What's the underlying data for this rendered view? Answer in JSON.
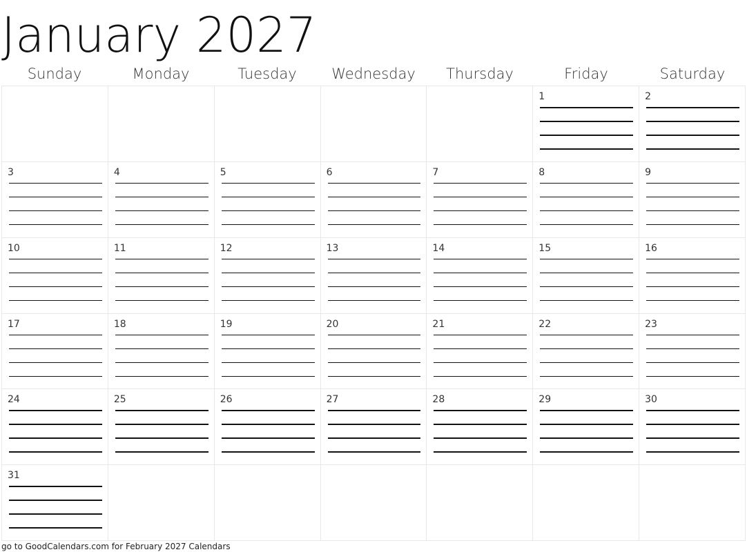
{
  "calendar": {
    "title": "January 2027",
    "weekdays": [
      "Sunday",
      "Monday",
      "Tuesday",
      "Wednesday",
      "Thursday",
      "Friday",
      "Saturday"
    ],
    "first_weekday_index": 5,
    "days_in_month": 31,
    "lines_per_day": 4,
    "weeks_shown": 6
  },
  "footer": {
    "text": "go to GoodCalendars.com for February 2027 Calendars"
  }
}
